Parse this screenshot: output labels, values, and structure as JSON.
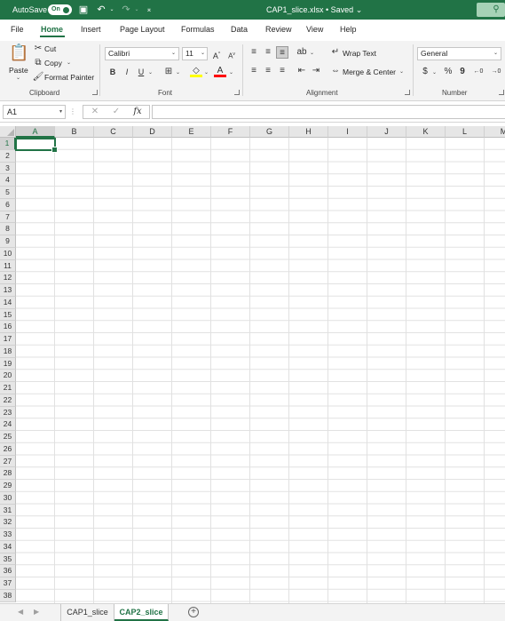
{
  "titlebar": {
    "autosave_label": "AutoSave",
    "autosave_state": "On",
    "filename": "CAP1_slice.xlsx • Saved ⌄",
    "accent_color": "#217346"
  },
  "tabs": [
    "File",
    "Home",
    "Insert",
    "Page Layout",
    "Formulas",
    "Data",
    "Review",
    "View",
    "Help"
  ],
  "active_tab": "Home",
  "ribbon": {
    "clipboard": {
      "group": "Clipboard",
      "paste": "Paste",
      "cut": "Cut",
      "copy": "Copy",
      "format_painter": "Format Painter"
    },
    "font": {
      "group": "Font",
      "name": "Calibri",
      "size": "11",
      "bold": "B",
      "italic": "I",
      "underline": "U"
    },
    "alignment": {
      "group": "Alignment",
      "wrap_text": "Wrap Text",
      "merge_center": "Merge & Center"
    },
    "number": {
      "group": "Number",
      "format": "General",
      "currency": "$",
      "percent": "%",
      "comma": "9"
    }
  },
  "formula_bar": {
    "name_box": "A1",
    "cancel": "✕",
    "enter": "✓",
    "fx": "fx",
    "value": ""
  },
  "grid": {
    "columns": [
      "A",
      "B",
      "C",
      "D",
      "E",
      "F",
      "G",
      "H",
      "I",
      "J",
      "K",
      "L",
      "M"
    ],
    "rows": [
      "1",
      "2",
      "3",
      "4",
      "5",
      "6",
      "7",
      "8",
      "9",
      "10",
      "11",
      "12",
      "13",
      "14",
      "15",
      "16",
      "17",
      "18",
      "19",
      "20",
      "21",
      "22",
      "23",
      "24",
      "25",
      "26",
      "27",
      "28",
      "29",
      "30",
      "31",
      "32",
      "33",
      "34",
      "35",
      "36",
      "37",
      "38"
    ],
    "active_cell": "A1"
  },
  "sheets": {
    "tabs": [
      "CAP1_slice",
      "CAP2_slice"
    ],
    "active": "CAP2_slice",
    "add": "+"
  }
}
